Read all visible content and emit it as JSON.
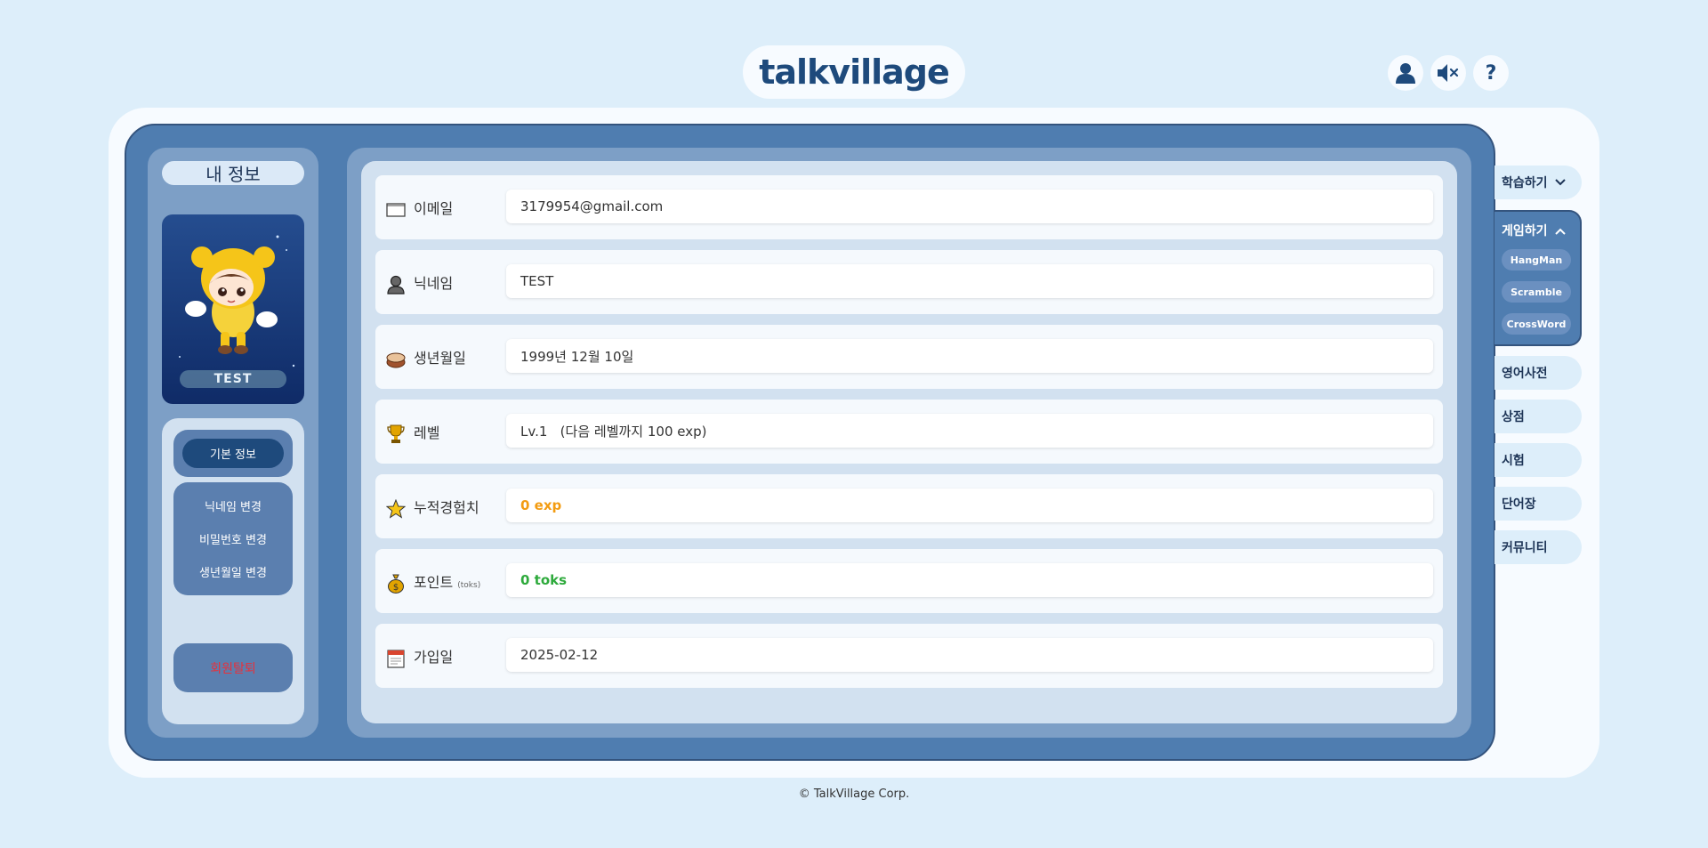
{
  "header": {
    "logo": "talkvillage",
    "icons": [
      "user-icon",
      "mute-icon",
      "help-icon"
    ],
    "help_glyph": "?"
  },
  "left": {
    "title": "내 정보",
    "avatar_name": "TEST",
    "menu": {
      "basic_info": "기본 정보",
      "change_nickname": "닉네임 변경",
      "change_password": "비밀번호 변경",
      "change_birthday": "생년월일 변경",
      "withdraw": "회원탈퇴"
    }
  },
  "profile": {
    "email_label": "이메일",
    "email": "3179954@gmail.com",
    "nickname_label": "닉네임",
    "nickname": "TEST",
    "birthday_label": "생년월일",
    "birthday": "1999년 12월 10일",
    "level_label": "레벨",
    "level": "Lv.1   (다음 레벨까지 100 exp)",
    "exp_label": "누적경험치",
    "exp": "0 exp",
    "points_label": "포인트",
    "points_unit": "(toks)",
    "points": "0 toks",
    "joined_label": "가입일",
    "joined": "2025-02-12"
  },
  "nav": {
    "study": "학습하기",
    "game": "게임하기",
    "game_sub": [
      "HangMan",
      "Scramble",
      "CrossWord"
    ],
    "dictionary": "영어사전",
    "shop": "상점",
    "exam": "시험",
    "wordbook": "단어장",
    "community": "커뮤니티"
  },
  "footer": "© TalkVillage Corp.",
  "colors": {
    "background": "#ddeefa",
    "board": "#4f7db0",
    "accent": "#1e4a7c",
    "exp": "#f39c12",
    "toks": "#2eaa3c",
    "withdraw": "#e8303a"
  }
}
